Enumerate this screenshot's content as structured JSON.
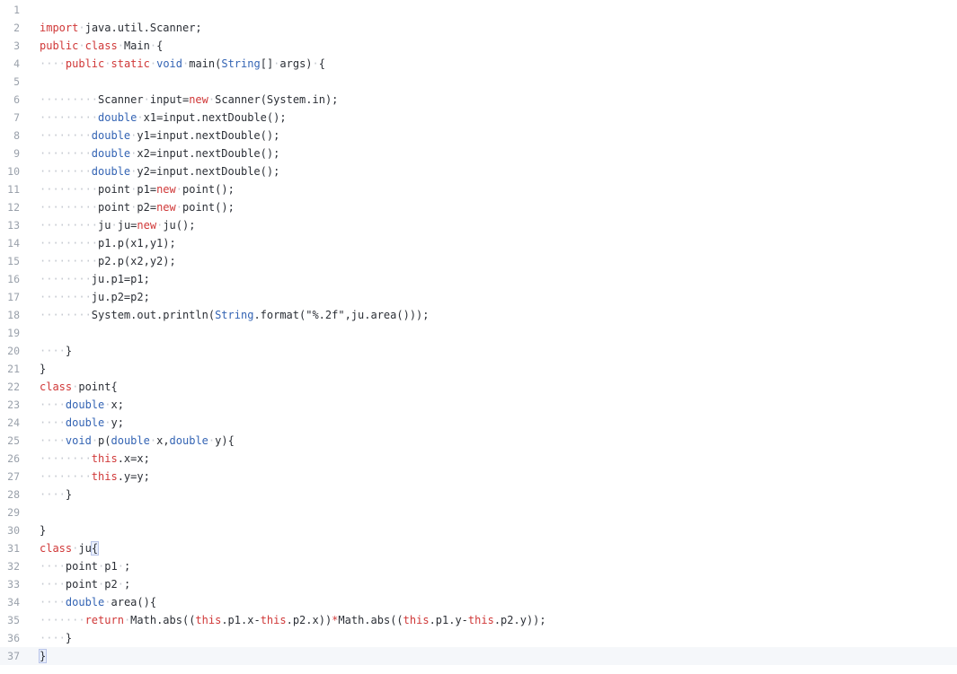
{
  "editor": {
    "language": "java",
    "current_line": 37,
    "lines": [
      {
        "n": "1",
        "tokens": []
      },
      {
        "n": "2",
        "tokens": [
          [
            "kw",
            "import"
          ],
          [
            "ws",
            "·"
          ],
          [
            "tx",
            "java.util.Scanner;"
          ]
        ]
      },
      {
        "n": "3",
        "tokens": [
          [
            "kw",
            "public"
          ],
          [
            "ws",
            "·"
          ],
          [
            "kw",
            "class"
          ],
          [
            "ws",
            "·"
          ],
          [
            "tx",
            "Main"
          ],
          [
            "ws",
            "·"
          ],
          [
            "tx",
            "{"
          ]
        ]
      },
      {
        "n": "4",
        "tokens": [
          [
            "ws",
            "····"
          ],
          [
            "kw",
            "public"
          ],
          [
            "ws",
            "·"
          ],
          [
            "kw",
            "static"
          ],
          [
            "ws",
            "·"
          ],
          [
            "ty",
            "void"
          ],
          [
            "ws",
            "·"
          ],
          [
            "tx",
            "main("
          ],
          [
            "ty",
            "String"
          ],
          [
            "tx",
            "[]"
          ],
          [
            "ws",
            "·"
          ],
          [
            "tx",
            "args)"
          ],
          [
            "ws",
            "·"
          ],
          [
            "tx",
            "{"
          ]
        ]
      },
      {
        "n": "5",
        "tokens": []
      },
      {
        "n": "6",
        "tokens": [
          [
            "ws",
            "·········"
          ],
          [
            "tx",
            "Scanner"
          ],
          [
            "ws",
            "·"
          ],
          [
            "tx",
            "input="
          ],
          [
            "kw",
            "new"
          ],
          [
            "ws",
            "·"
          ],
          [
            "tx",
            "Scanner(System.in);"
          ]
        ]
      },
      {
        "n": "7",
        "tokens": [
          [
            "ws",
            "·········"
          ],
          [
            "ty",
            "double"
          ],
          [
            "ws",
            "·"
          ],
          [
            "tx",
            "x1=input.nextDouble();"
          ]
        ]
      },
      {
        "n": "8",
        "tokens": [
          [
            "ws",
            "········"
          ],
          [
            "ty",
            "double"
          ],
          [
            "ws",
            "·"
          ],
          [
            "tx",
            "y1=input.nextDouble();"
          ]
        ]
      },
      {
        "n": "9",
        "tokens": [
          [
            "ws",
            "········"
          ],
          [
            "ty",
            "double"
          ],
          [
            "ws",
            "·"
          ],
          [
            "tx",
            "x2=input.nextDouble();"
          ]
        ]
      },
      {
        "n": "10",
        "tokens": [
          [
            "ws",
            "········"
          ],
          [
            "ty",
            "double"
          ],
          [
            "ws",
            "·"
          ],
          [
            "tx",
            "y2=input.nextDouble();"
          ]
        ]
      },
      {
        "n": "11",
        "tokens": [
          [
            "ws",
            "·········"
          ],
          [
            "tx",
            "point"
          ],
          [
            "ws",
            "·"
          ],
          [
            "tx",
            "p1="
          ],
          [
            "kw",
            "new"
          ],
          [
            "ws",
            "·"
          ],
          [
            "tx",
            "point();"
          ]
        ]
      },
      {
        "n": "12",
        "tokens": [
          [
            "ws",
            "·········"
          ],
          [
            "tx",
            "point"
          ],
          [
            "ws",
            "·"
          ],
          [
            "tx",
            "p2="
          ],
          [
            "kw",
            "new"
          ],
          [
            "ws",
            "·"
          ],
          [
            "tx",
            "point();"
          ]
        ]
      },
      {
        "n": "13",
        "tokens": [
          [
            "ws",
            "·········"
          ],
          [
            "tx",
            "ju"
          ],
          [
            "ws",
            "·"
          ],
          [
            "tx",
            "ju="
          ],
          [
            "kw",
            "new"
          ],
          [
            "ws",
            "·"
          ],
          [
            "tx",
            "ju();"
          ]
        ]
      },
      {
        "n": "14",
        "tokens": [
          [
            "ws",
            "·········"
          ],
          [
            "tx",
            "p1.p(x1,y1);"
          ]
        ]
      },
      {
        "n": "15",
        "tokens": [
          [
            "ws",
            "·········"
          ],
          [
            "tx",
            "p2.p(x2,y2);"
          ]
        ]
      },
      {
        "n": "16",
        "tokens": [
          [
            "ws",
            "········"
          ],
          [
            "tx",
            "ju.p1=p1;"
          ]
        ]
      },
      {
        "n": "17",
        "tokens": [
          [
            "ws",
            "········"
          ],
          [
            "tx",
            "ju.p2=p2;"
          ]
        ]
      },
      {
        "n": "18",
        "tokens": [
          [
            "ws",
            "········"
          ],
          [
            "tx",
            "System.out.println("
          ],
          [
            "ty",
            "String"
          ],
          [
            "tx",
            ".format(\"%.2f\",ju.area()));"
          ]
        ]
      },
      {
        "n": "19",
        "tokens": []
      },
      {
        "n": "20",
        "tokens": [
          [
            "ws",
            "····"
          ],
          [
            "tx",
            "}"
          ]
        ]
      },
      {
        "n": "21",
        "tokens": [
          [
            "tx",
            "}"
          ]
        ]
      },
      {
        "n": "22",
        "tokens": [
          [
            "kw",
            "class"
          ],
          [
            "ws",
            "·"
          ],
          [
            "tx",
            "point{"
          ]
        ]
      },
      {
        "n": "23",
        "tokens": [
          [
            "ws",
            "····"
          ],
          [
            "ty",
            "double"
          ],
          [
            "ws",
            "·"
          ],
          [
            "tx",
            "x;"
          ]
        ]
      },
      {
        "n": "24",
        "tokens": [
          [
            "ws",
            "····"
          ],
          [
            "ty",
            "double"
          ],
          [
            "ws",
            "·"
          ],
          [
            "tx",
            "y;"
          ]
        ]
      },
      {
        "n": "25",
        "tokens": [
          [
            "ws",
            "····"
          ],
          [
            "ty",
            "void"
          ],
          [
            "ws",
            "·"
          ],
          [
            "tx",
            "p("
          ],
          [
            "ty",
            "double"
          ],
          [
            "ws",
            "·"
          ],
          [
            "tx",
            "x,"
          ],
          [
            "ty",
            "double"
          ],
          [
            "ws",
            "·"
          ],
          [
            "tx",
            "y){"
          ]
        ]
      },
      {
        "n": "26",
        "tokens": [
          [
            "ws",
            "········"
          ],
          [
            "kw",
            "this"
          ],
          [
            "tx",
            ".x=x;"
          ]
        ]
      },
      {
        "n": "27",
        "tokens": [
          [
            "ws",
            "········"
          ],
          [
            "kw",
            "this"
          ],
          [
            "tx",
            ".y=y;"
          ]
        ]
      },
      {
        "n": "28",
        "tokens": [
          [
            "ws",
            "····"
          ],
          [
            "tx",
            "}"
          ]
        ]
      },
      {
        "n": "29",
        "tokens": []
      },
      {
        "n": "30",
        "tokens": [
          [
            "tx",
            "}"
          ]
        ]
      },
      {
        "n": "31",
        "tokens": [
          [
            "kw",
            "class"
          ],
          [
            "ws",
            "·"
          ],
          [
            "tx",
            "ju"
          ],
          [
            "hl",
            "{"
          ]
        ]
      },
      {
        "n": "32",
        "tokens": [
          [
            "ws",
            "····"
          ],
          [
            "tx",
            "point"
          ],
          [
            "ws",
            "·"
          ],
          [
            "tx",
            "p1"
          ],
          [
            "ws",
            "·"
          ],
          [
            "tx",
            ";"
          ]
        ]
      },
      {
        "n": "33",
        "tokens": [
          [
            "ws",
            "····"
          ],
          [
            "tx",
            "point"
          ],
          [
            "ws",
            "·"
          ],
          [
            "tx",
            "p2"
          ],
          [
            "ws",
            "·"
          ],
          [
            "tx",
            ";"
          ]
        ]
      },
      {
        "n": "34",
        "tokens": [
          [
            "ws",
            "····"
          ],
          [
            "ty",
            "double"
          ],
          [
            "ws",
            "·"
          ],
          [
            "tx",
            "area(){"
          ]
        ]
      },
      {
        "n": "35",
        "tokens": [
          [
            "ws",
            "·······"
          ],
          [
            "kw",
            "return"
          ],
          [
            "ws",
            "·"
          ],
          [
            "tx",
            "Math.abs(("
          ],
          [
            "kw",
            "this"
          ],
          [
            "tx",
            ".p1.x-"
          ],
          [
            "kw",
            "this"
          ],
          [
            "tx",
            ".p2.x))"
          ],
          [
            "kw",
            "*"
          ],
          [
            "tx",
            "Math.abs(("
          ],
          [
            "kw",
            "this"
          ],
          [
            "tx",
            ".p1.y-"
          ],
          [
            "kw",
            "this"
          ],
          [
            "tx",
            ".p2.y));"
          ]
        ]
      },
      {
        "n": "36",
        "tokens": [
          [
            "ws",
            "····"
          ],
          [
            "tx",
            "}"
          ]
        ]
      },
      {
        "n": "37",
        "tokens": [
          [
            "cur",
            ""
          ],
          [
            "hl",
            "}"
          ]
        ]
      }
    ]
  }
}
